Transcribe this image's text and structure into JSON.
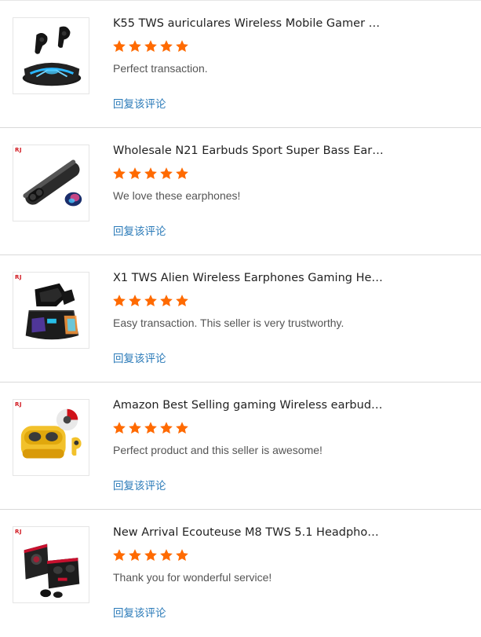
{
  "accent": {
    "star_color": "#ff6a00",
    "link_color": "#2a7ab8"
  },
  "reviews": [
    {
      "product_title": "K55 TWS auriculares Wireless Mobile Gamer E...",
      "rating": 5,
      "comment": "Perfect transaction.",
      "reply_label": "回复该评论",
      "image_badge": "",
      "image_icon": "gamer-earbuds-blue-glow-case"
    },
    {
      "product_title": "Wholesale N21 Earbuds Sport Super Bass Earp...",
      "rating": 5,
      "comment": "We love these earphones!",
      "reply_label": "回复该评论",
      "image_badge": "RJ",
      "image_icon": "cylindrical-charging-case-earbuds"
    },
    {
      "product_title": "X1 TWS Alien Wireless Earphones Gaming Hea...",
      "rating": 5,
      "comment": "Easy transaction. This seller is very trustworthy.",
      "reply_label": "回复该评论",
      "image_badge": "RJ",
      "image_icon": "alien-gaming-earphones-rgb-case"
    },
    {
      "product_title": "Amazon Best Selling gaming Wireless earbuds ...",
      "rating": 5,
      "comment": "Perfect product and this seller is awesome!",
      "reply_label": "回复该评论",
      "image_badge": "RJ",
      "image_icon": "yellow-earbuds-case"
    },
    {
      "product_title": "New Arrival Ecouteuse M8 TWS 5.1 Headphon...",
      "rating": 5,
      "comment": "Thank you for wonderful service!",
      "reply_label": "回复该评论",
      "image_badge": "RJ",
      "image_icon": "black-red-square-case-earbuds"
    }
  ]
}
